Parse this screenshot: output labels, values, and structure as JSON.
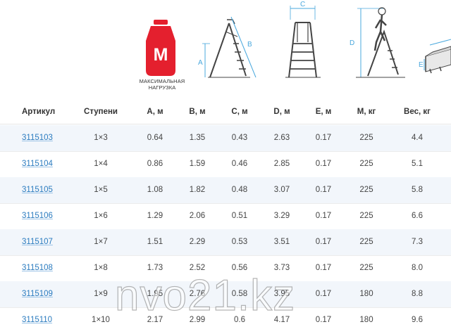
{
  "header": {
    "weight_icon_letter": "M",
    "weight_caption": "МАКСИМАЛЬНАЯ\nНАГРУЗКА",
    "diagram_labels": {
      "a": "A",
      "b": "B",
      "c": "C",
      "d": "D",
      "e": "E"
    },
    "colors": {
      "weight_red": "#e4202e",
      "dimension_blue": "#4aa8dd"
    }
  },
  "table": {
    "columns": [
      "Артикул",
      "Ступени",
      "А, м",
      "В, м",
      "С, м",
      "D, м",
      "Е, м",
      "М, кг",
      "Вес, кг"
    ],
    "rows": [
      [
        "3115103",
        "1×3",
        "0.64",
        "1.35",
        "0.43",
        "2.63",
        "0.17",
        "225",
        "4.4"
      ],
      [
        "3115104",
        "1×4",
        "0.86",
        "1.59",
        "0.46",
        "2.85",
        "0.17",
        "225",
        "5.1"
      ],
      [
        "3115105",
        "1×5",
        "1.08",
        "1.82",
        "0.48",
        "3.07",
        "0.17",
        "225",
        "5.8"
      ],
      [
        "3115106",
        "1×6",
        "1.29",
        "2.06",
        "0.51",
        "3.29",
        "0.17",
        "225",
        "6.6"
      ],
      [
        "3115107",
        "1×7",
        "1.51",
        "2.29",
        "0.53",
        "3.51",
        "0.17",
        "225",
        "7.3"
      ],
      [
        "3115108",
        "1×8",
        "1.73",
        "2.52",
        "0.56",
        "3.73",
        "0.17",
        "225",
        "8.0"
      ],
      [
        "3115109",
        "1×9",
        "1.95",
        "2.76",
        "0.58",
        "3.95",
        "0.17",
        "180",
        "8.8"
      ],
      [
        "3115110",
        "1×10",
        "2.17",
        "2.99",
        "0.6",
        "4.17",
        "0.17",
        "180",
        "9.6"
      ]
    ]
  },
  "watermark": "nvo21.kz"
}
